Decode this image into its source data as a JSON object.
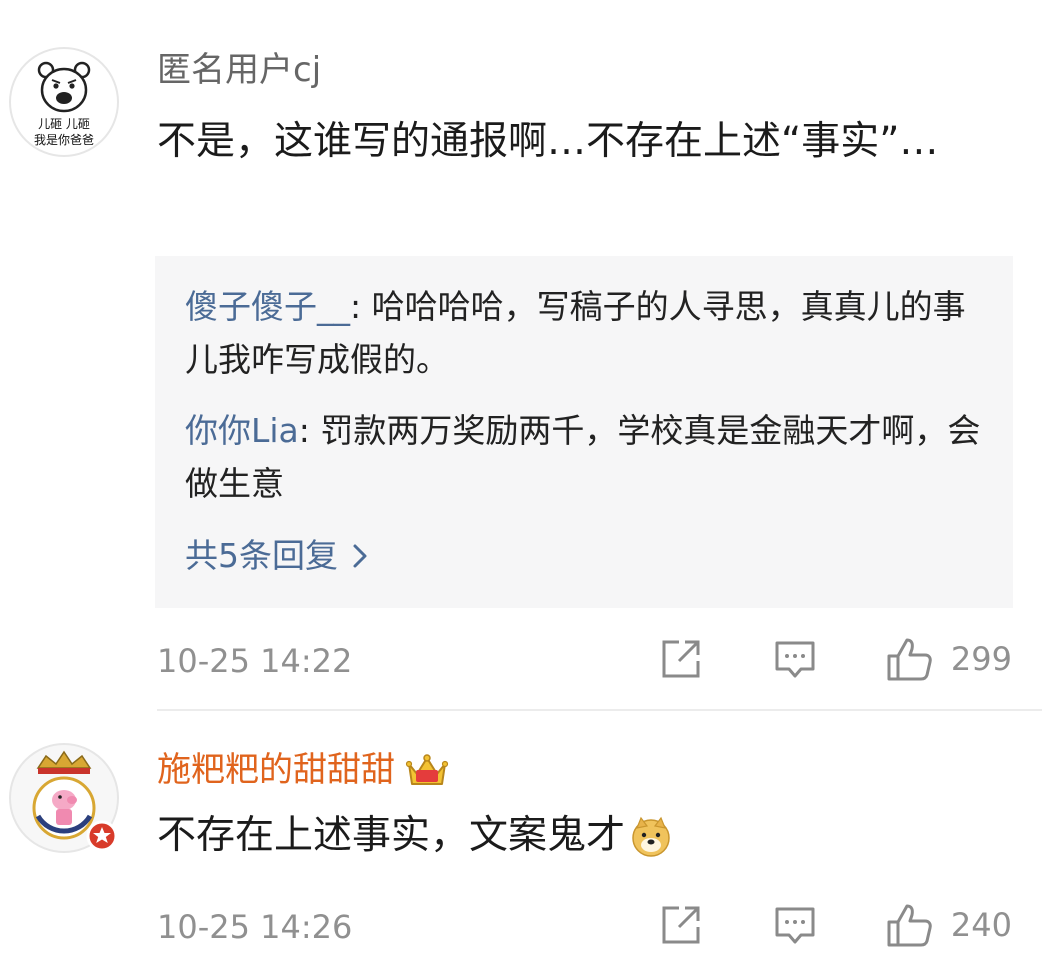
{
  "comments": [
    {
      "username": "匿名用户cj",
      "avatar_caption_line1": "儿砸 儿砸",
      "avatar_caption_line2": "我是你爸爸",
      "text": "不是，这谁写的通报啊…不存在上述“事实”…",
      "replies": [
        {
          "name": "傻子傻子__",
          "text": "哈哈哈哈，写稿子的人寻思，真真儿的事儿我咋写成假的。"
        },
        {
          "name": "你你Lia",
          "text": "罚款两万奖励两千，学校真是金融天才啊，会做生意"
        }
      ],
      "more_replies": "共5条回复",
      "time": "10-25 14:22",
      "likes": "299"
    },
    {
      "username": "施粑粑的甜甜甜",
      "text": "不存在上述事实，文案鬼才",
      "emoji": "doge-emoji",
      "badge_icon": "crown-icon",
      "time": "10-25 14:26",
      "likes": "240"
    }
  ],
  "icons": {
    "share": "share-icon",
    "comment": "comment-icon",
    "like": "thumbs-up-icon",
    "chevron": "chevron-right-icon"
  },
  "colors": {
    "link": "#4b6b96",
    "vip_name": "#e0641d",
    "meta": "#909090",
    "reply_bg": "#f6f6f7"
  }
}
